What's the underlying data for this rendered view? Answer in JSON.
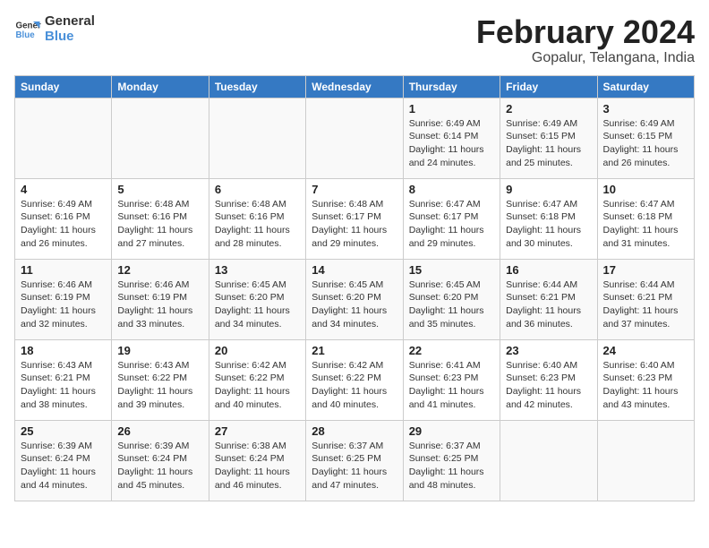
{
  "header": {
    "logo_line1": "General",
    "logo_line2": "Blue",
    "month_year": "February 2024",
    "location": "Gopalur, Telangana, India"
  },
  "weekdays": [
    "Sunday",
    "Monday",
    "Tuesday",
    "Wednesday",
    "Thursday",
    "Friday",
    "Saturday"
  ],
  "weeks": [
    [
      {
        "day": "",
        "info": ""
      },
      {
        "day": "",
        "info": ""
      },
      {
        "day": "",
        "info": ""
      },
      {
        "day": "",
        "info": ""
      },
      {
        "day": "1",
        "info": "Sunrise: 6:49 AM\nSunset: 6:14 PM\nDaylight: 11 hours\nand 24 minutes."
      },
      {
        "day": "2",
        "info": "Sunrise: 6:49 AM\nSunset: 6:15 PM\nDaylight: 11 hours\nand 25 minutes."
      },
      {
        "day": "3",
        "info": "Sunrise: 6:49 AM\nSunset: 6:15 PM\nDaylight: 11 hours\nand 26 minutes."
      }
    ],
    [
      {
        "day": "4",
        "info": "Sunrise: 6:49 AM\nSunset: 6:16 PM\nDaylight: 11 hours\nand 26 minutes."
      },
      {
        "day": "5",
        "info": "Sunrise: 6:48 AM\nSunset: 6:16 PM\nDaylight: 11 hours\nand 27 minutes."
      },
      {
        "day": "6",
        "info": "Sunrise: 6:48 AM\nSunset: 6:16 PM\nDaylight: 11 hours\nand 28 minutes."
      },
      {
        "day": "7",
        "info": "Sunrise: 6:48 AM\nSunset: 6:17 PM\nDaylight: 11 hours\nand 29 minutes."
      },
      {
        "day": "8",
        "info": "Sunrise: 6:47 AM\nSunset: 6:17 PM\nDaylight: 11 hours\nand 29 minutes."
      },
      {
        "day": "9",
        "info": "Sunrise: 6:47 AM\nSunset: 6:18 PM\nDaylight: 11 hours\nand 30 minutes."
      },
      {
        "day": "10",
        "info": "Sunrise: 6:47 AM\nSunset: 6:18 PM\nDaylight: 11 hours\nand 31 minutes."
      }
    ],
    [
      {
        "day": "11",
        "info": "Sunrise: 6:46 AM\nSunset: 6:19 PM\nDaylight: 11 hours\nand 32 minutes."
      },
      {
        "day": "12",
        "info": "Sunrise: 6:46 AM\nSunset: 6:19 PM\nDaylight: 11 hours\nand 33 minutes."
      },
      {
        "day": "13",
        "info": "Sunrise: 6:45 AM\nSunset: 6:20 PM\nDaylight: 11 hours\nand 34 minutes."
      },
      {
        "day": "14",
        "info": "Sunrise: 6:45 AM\nSunset: 6:20 PM\nDaylight: 11 hours\nand 34 minutes."
      },
      {
        "day": "15",
        "info": "Sunrise: 6:45 AM\nSunset: 6:20 PM\nDaylight: 11 hours\nand 35 minutes."
      },
      {
        "day": "16",
        "info": "Sunrise: 6:44 AM\nSunset: 6:21 PM\nDaylight: 11 hours\nand 36 minutes."
      },
      {
        "day": "17",
        "info": "Sunrise: 6:44 AM\nSunset: 6:21 PM\nDaylight: 11 hours\nand 37 minutes."
      }
    ],
    [
      {
        "day": "18",
        "info": "Sunrise: 6:43 AM\nSunset: 6:21 PM\nDaylight: 11 hours\nand 38 minutes."
      },
      {
        "day": "19",
        "info": "Sunrise: 6:43 AM\nSunset: 6:22 PM\nDaylight: 11 hours\nand 39 minutes."
      },
      {
        "day": "20",
        "info": "Sunrise: 6:42 AM\nSunset: 6:22 PM\nDaylight: 11 hours\nand 40 minutes."
      },
      {
        "day": "21",
        "info": "Sunrise: 6:42 AM\nSunset: 6:22 PM\nDaylight: 11 hours\nand 40 minutes."
      },
      {
        "day": "22",
        "info": "Sunrise: 6:41 AM\nSunset: 6:23 PM\nDaylight: 11 hours\nand 41 minutes."
      },
      {
        "day": "23",
        "info": "Sunrise: 6:40 AM\nSunset: 6:23 PM\nDaylight: 11 hours\nand 42 minutes."
      },
      {
        "day": "24",
        "info": "Sunrise: 6:40 AM\nSunset: 6:23 PM\nDaylight: 11 hours\nand 43 minutes."
      }
    ],
    [
      {
        "day": "25",
        "info": "Sunrise: 6:39 AM\nSunset: 6:24 PM\nDaylight: 11 hours\nand 44 minutes."
      },
      {
        "day": "26",
        "info": "Sunrise: 6:39 AM\nSunset: 6:24 PM\nDaylight: 11 hours\nand 45 minutes."
      },
      {
        "day": "27",
        "info": "Sunrise: 6:38 AM\nSunset: 6:24 PM\nDaylight: 11 hours\nand 46 minutes."
      },
      {
        "day": "28",
        "info": "Sunrise: 6:37 AM\nSunset: 6:25 PM\nDaylight: 11 hours\nand 47 minutes."
      },
      {
        "day": "29",
        "info": "Sunrise: 6:37 AM\nSunset: 6:25 PM\nDaylight: 11 hours\nand 48 minutes."
      },
      {
        "day": "",
        "info": ""
      },
      {
        "day": "",
        "info": ""
      }
    ]
  ]
}
